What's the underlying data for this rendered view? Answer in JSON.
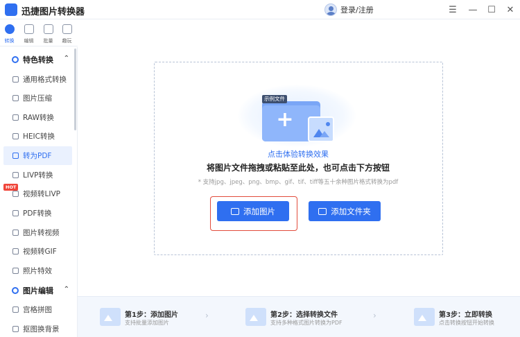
{
  "app": {
    "title": "迅捷图片转换器",
    "login": "登录/注册"
  },
  "window": {
    "menu_icon": "☰",
    "minimize_icon": "—",
    "maximize_icon": "☐",
    "close_icon": "✕"
  },
  "rail": [
    {
      "label": "转换",
      "active": true
    },
    {
      "label": "编辑",
      "active": false
    },
    {
      "label": "批量",
      "active": false
    },
    {
      "label": "趣玩",
      "active": false
    }
  ],
  "sidebar": {
    "section_convert": "特色转换",
    "section_edit": "图片编辑",
    "items": [
      "通用格式转换",
      "图片压缩",
      "RAW转换",
      "HEIC转换",
      "转为PDF",
      "LIVP转换",
      "视频转LIVP",
      "PDF转换",
      "图片转视频",
      "视频转GIF",
      "照片特效"
    ],
    "edit_items": [
      "宫格拼图",
      "抠图换背景"
    ],
    "active_item": "转为PDF",
    "hot_badge": "HOT",
    "chevron": "⌃"
  },
  "main": {
    "sample_tag": "示例文件",
    "try_link": "点击体验转换效果",
    "drop_hint": "将图片文件拖拽或粘贴至此处，也可点击下方按钮",
    "formats": "* 支持jpg、jpeg、png、bmp、gif、tif、tiff等五十余种图片格式转换为pdf",
    "add_image": "添加图片",
    "add_folder": "添加文件夹",
    "plus": "+"
  },
  "steps": [
    {
      "title": "第1步：添加图片",
      "desc": "支持批量添加图片"
    },
    {
      "title": "第2步：选择转换文件",
      "desc": "支持多种格式图片转换为PDF"
    },
    {
      "title": "第3步：立即转换",
      "desc": "点击转换按钮开始转换"
    }
  ],
  "step_arrow": "›",
  "colors": {
    "accent": "#2f6ff0",
    "highlight": "#e24b3b",
    "hot": "#f0453a"
  }
}
